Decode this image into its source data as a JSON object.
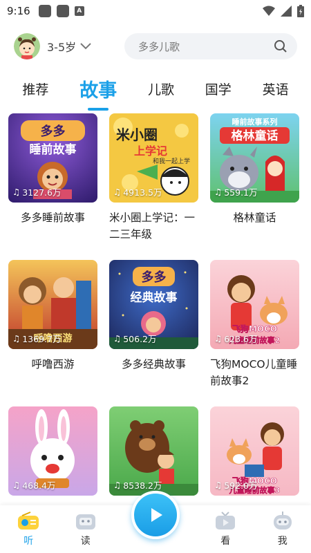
{
  "status_bar": {
    "time": "9:16"
  },
  "header": {
    "age_label": "3-5岁",
    "search_placeholder": "多多儿歌"
  },
  "tabs": [
    {
      "label": "推荐",
      "active": false
    },
    {
      "label": "故事",
      "active": true
    },
    {
      "label": "儿歌",
      "active": false
    },
    {
      "label": "国学",
      "active": false
    },
    {
      "label": "英语",
      "active": false
    }
  ],
  "cards": [
    {
      "cover_text": "多多 睡前故事",
      "plays": "3127.6万",
      "title": "多多睡前故事",
      "bg": "#4a2d8f"
    },
    {
      "cover_text": "米小圈上学记 和我一起上学",
      "plays": "4913.5万",
      "title": "米小圈上学记：一二三年级",
      "bg": "#f5c842"
    },
    {
      "cover_text": "睡前故事系列 格林童话",
      "plays": "559.1万",
      "title": "格林童话",
      "bg": "#5fc06e"
    },
    {
      "cover_text": "",
      "plays": "1369.7万",
      "title": "呼噜西游",
      "bg": "#e89a38"
    },
    {
      "cover_text": "多多 经典故事",
      "plays": "506.2万",
      "title": "多多经典故事",
      "bg": "#2c3f8c"
    },
    {
      "cover_text": "飞狗MOCO 儿童睡前故事2",
      "plays": "623.6万",
      "title": "飞狗MOCO儿童睡前故事2",
      "bg": "#f4a9b4"
    },
    {
      "cover_text": "",
      "plays": "468.4万",
      "title": "",
      "bg": "#e8a0c8"
    },
    {
      "cover_text": "",
      "plays": "8538.2万",
      "title": "",
      "bg": "#6cc36a"
    },
    {
      "cover_text": "飞狗MOCO 儿童睡前故事3",
      "plays": "592.0万",
      "title": "",
      "bg": "#f6b8c4"
    }
  ],
  "bottom_nav": [
    {
      "label": "听",
      "active": true
    },
    {
      "label": "读",
      "active": false
    },
    {
      "label": "看",
      "active": false
    },
    {
      "label": "我",
      "active": false
    }
  ],
  "colors": {
    "accent": "#1aa0e8"
  }
}
